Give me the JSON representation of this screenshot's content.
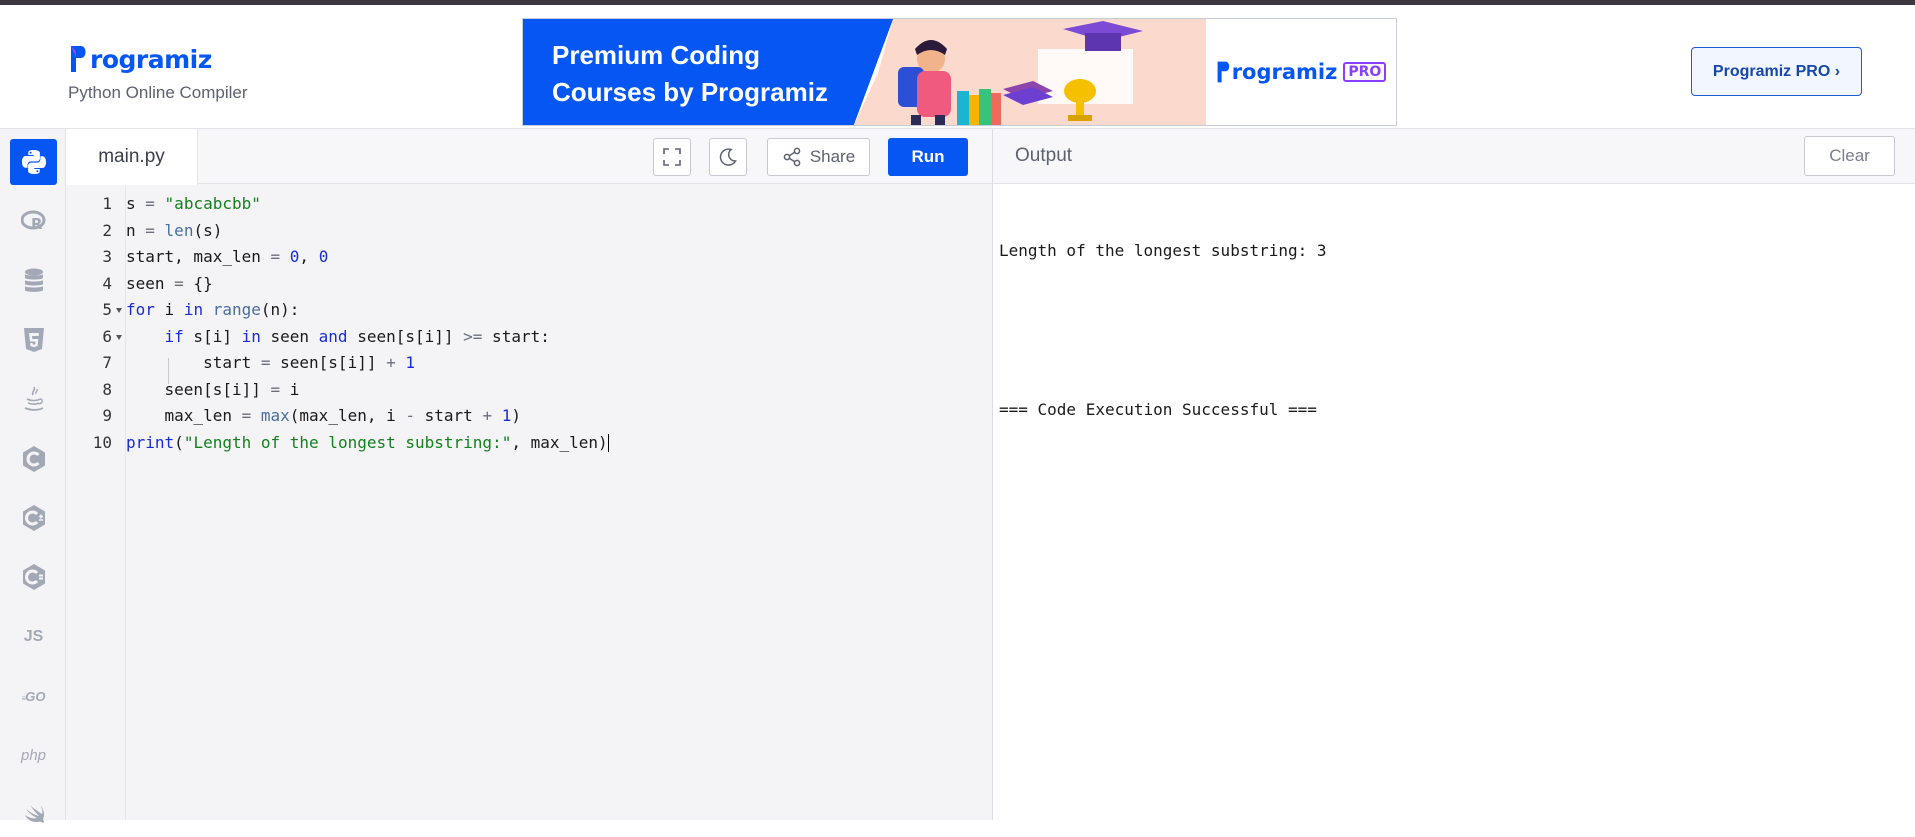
{
  "header": {
    "logo_text": "rogramiz",
    "subtitle": "Python Online Compiler",
    "banner": {
      "headline_line1": "Premium Coding",
      "headline_line2": "Courses by Programiz",
      "brand": "rogramiz",
      "badge": "PRO"
    },
    "pro_button": "Programiz PRO ›"
  },
  "sidebar": {
    "items": [
      {
        "icon": "python-icon",
        "label": "",
        "active": true
      },
      {
        "icon": "r-icon",
        "label": ""
      },
      {
        "icon": "database-icon",
        "label": ""
      },
      {
        "icon": "html5-icon",
        "label": ""
      },
      {
        "icon": "java-icon",
        "label": ""
      },
      {
        "icon": "c-icon",
        "label": ""
      },
      {
        "icon": "cpp-icon",
        "label": ""
      },
      {
        "icon": "csharp-icon",
        "label": ""
      },
      {
        "icon": "js-icon",
        "label": "JS"
      },
      {
        "icon": "go-icon",
        "label": "GO"
      },
      {
        "icon": "php-icon",
        "label": "php"
      },
      {
        "icon": "swift-icon",
        "label": ""
      }
    ]
  },
  "editor": {
    "file_tab": "main.py",
    "share_label": "Share",
    "run_label": "Run",
    "line_numbers": [
      "1",
      "2",
      "3",
      "4",
      "5",
      "6",
      "7",
      "8",
      "9",
      "10"
    ],
    "lines": [
      "s = \"abcabcbb\"",
      "n = len(s)",
      "start, max_len = 0, 0",
      "seen = {}",
      "for i in range(n):",
      "    if s[i] in seen and seen[s[i]] >= start:",
      "        start = seen[s[i]] + 1",
      "    seen[s[i]] = i",
      "    max_len = max(max_len, i - start + 1)",
      "print(\"Length of the longest substring:\", max_len)"
    ]
  },
  "output": {
    "title": "Output",
    "clear_label": "Clear",
    "lines": [
      "Length of the longest substring: 3",
      "",
      "=== Code Execution Successful ==="
    ]
  },
  "colors": {
    "accent": "#0556f3",
    "keyword": "#1a2bd8",
    "string": "#15801e"
  }
}
